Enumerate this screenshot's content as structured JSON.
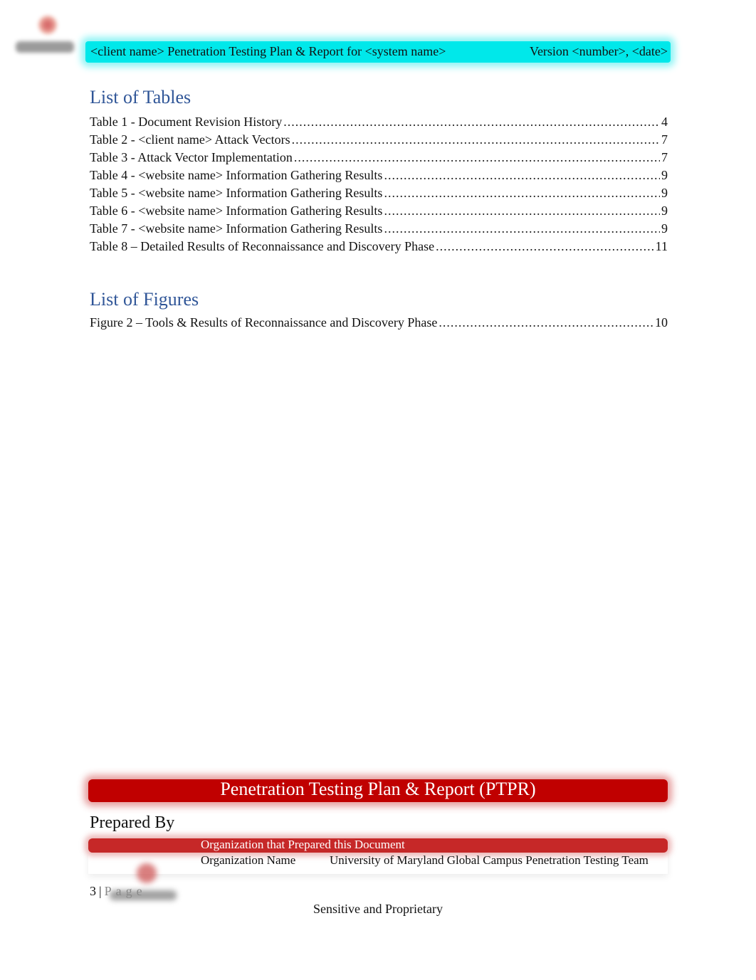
{
  "header": {
    "title": "<client name> Penetration Testing Plan & Report for <system name>",
    "version": "Version <number>, <date>",
    "highlight_color": "#00e8ea"
  },
  "list_of_tables": {
    "heading": "List of Tables",
    "entries": [
      {
        "label": "Table 1 - Document Revision History",
        "page": "4"
      },
      {
        "label": "Table 2 - <client name> Attack Vectors",
        "page": "7"
      },
      {
        "label": "Table 3 - Attack Vector Implementation",
        "page": "7"
      },
      {
        "label": "Table 4 - <website name> Information Gathering Results",
        "page": "9"
      },
      {
        "label": "Table 5 - <website name> Information Gathering Results",
        "page": "9"
      },
      {
        "label": "Table 6 - <website name> Information Gathering Results",
        "page": "9"
      },
      {
        "label": "Table 7 - <website name> Information Gathering Results",
        "page": "9"
      },
      {
        "label": "Table 8 – Detailed Results of Reconnaissance and Discovery Phase",
        "page": "11"
      }
    ]
  },
  "list_of_figures": {
    "heading": "List of Figures",
    "entries": [
      {
        "label": "Figure 2 – Tools & Results of Reconnaissance and Discovery Phase",
        "page": "10"
      }
    ]
  },
  "cover_block": {
    "title": "Penetration Testing Plan & Report (PTPR)",
    "prepared_by": "Prepared By",
    "table_header": "Organization that Prepared this Document",
    "org_label": "Organization Name",
    "org_value": "University of Maryland Global Campus Penetration Testing Team",
    "accent_color": "#c00000"
  },
  "footer": {
    "page_number": "3",
    "separator": "|",
    "page_word": "Page",
    "classification": "Sensitive and Proprietary"
  }
}
